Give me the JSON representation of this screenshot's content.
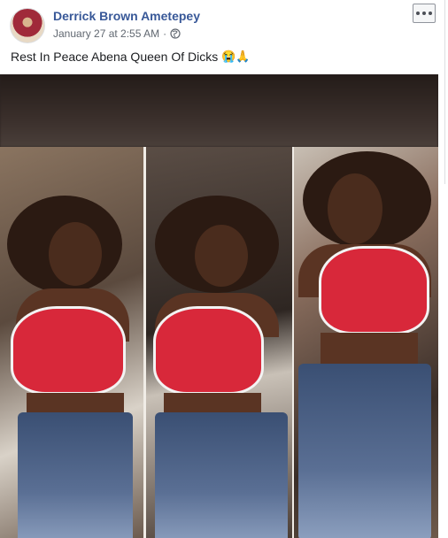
{
  "post": {
    "author": "Derrick Brown Ametepey",
    "timestamp": "January 27 at 2:55 AM",
    "separator": "·",
    "privacy_icon": "globe-icon",
    "caption": "Rest In Peace Abena Queen Of Dicks",
    "caption_emojis": "😭🙏",
    "more_icon": "more-options-icon"
  },
  "colors": {
    "author_link": "#385898",
    "meta_text": "#606770",
    "body_text": "#1c1e21"
  }
}
